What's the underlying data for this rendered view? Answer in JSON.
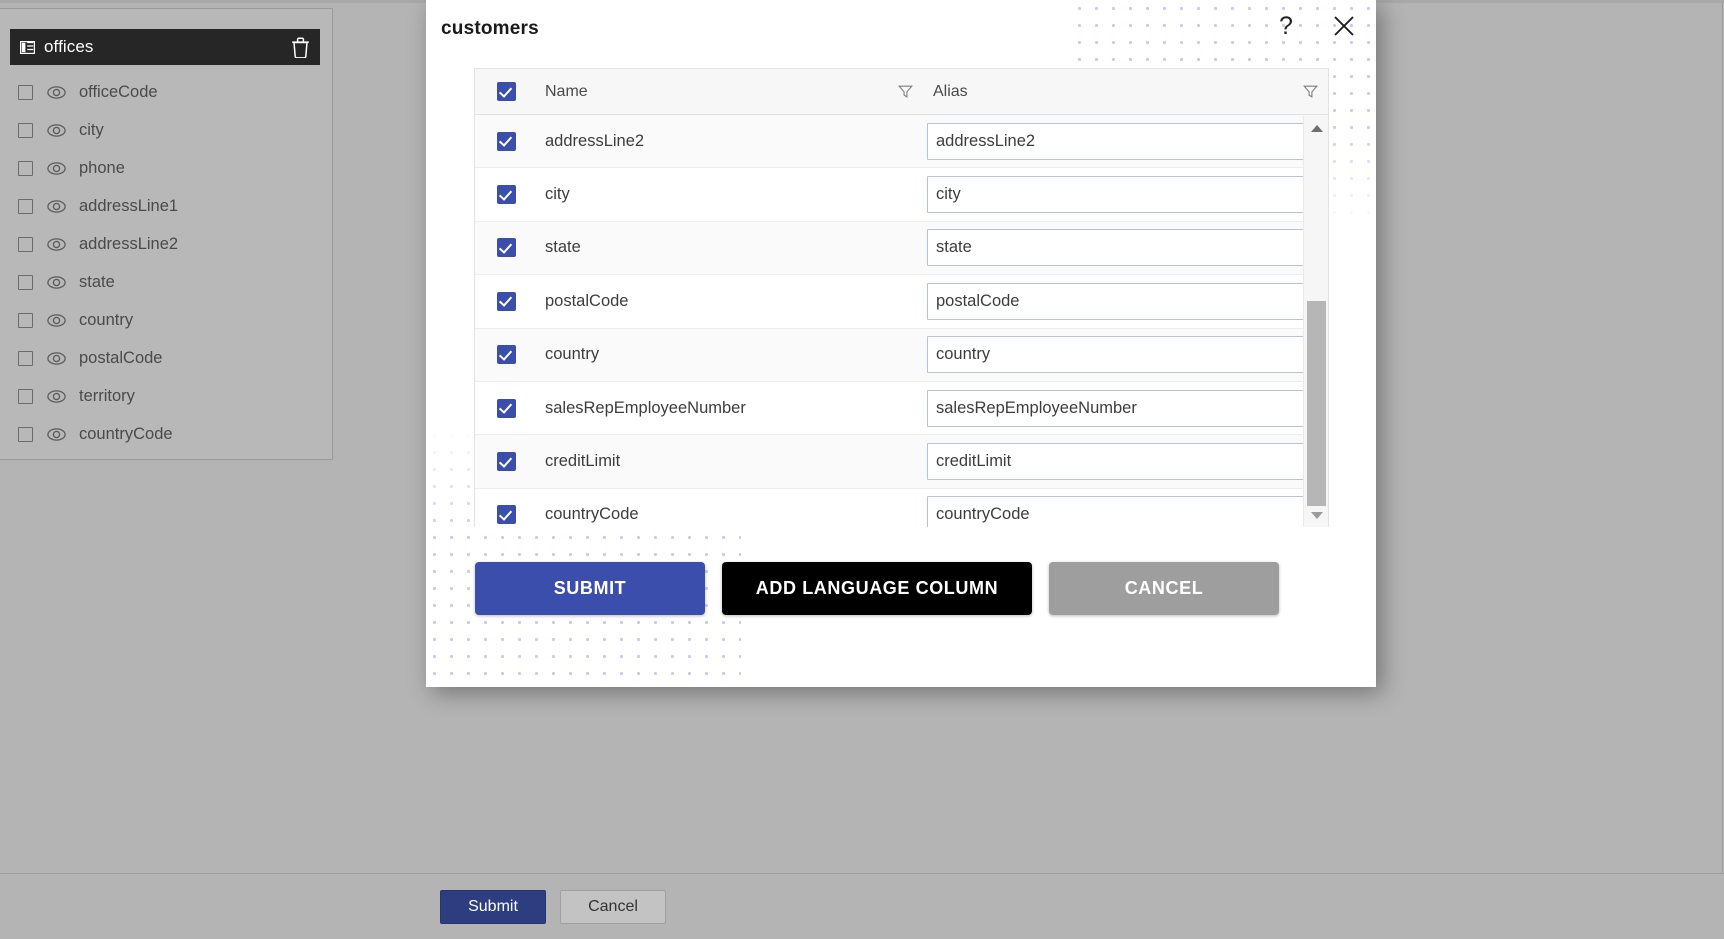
{
  "sidebar": {
    "header": {
      "icon": "table-grid-icon",
      "title": "offices",
      "delete_icon": "trash-icon"
    },
    "fields": [
      {
        "label": "officeCode"
      },
      {
        "label": "city"
      },
      {
        "label": "phone"
      },
      {
        "label": "addressLine1"
      },
      {
        "label": "addressLine2"
      },
      {
        "label": "state"
      },
      {
        "label": "country"
      },
      {
        "label": "postalCode"
      },
      {
        "label": "territory"
      },
      {
        "label": "countryCode"
      }
    ]
  },
  "dialog": {
    "title": "customers",
    "help_icon": "question-mark-icon",
    "close_icon": "close-icon",
    "table": {
      "header": {
        "select_all": true,
        "name_label": "Name",
        "alias_label": "Alias",
        "name_filter_icon": "filter-funnel-icon",
        "alias_filter_icon": "filter-funnel-icon"
      },
      "rows": [
        {
          "checked": true,
          "name": "addressLine2",
          "alias": "addressLine2"
        },
        {
          "checked": true,
          "name": "city",
          "alias": "city"
        },
        {
          "checked": true,
          "name": "state",
          "alias": "state"
        },
        {
          "checked": true,
          "name": "postalCode",
          "alias": "postalCode"
        },
        {
          "checked": true,
          "name": "country",
          "alias": "country"
        },
        {
          "checked": true,
          "name": "salesRepEmployeeNumber",
          "alias": "salesRepEmployeeNumber"
        },
        {
          "checked": true,
          "name": "creditLimit",
          "alias": "creditLimit"
        },
        {
          "checked": true,
          "name": "countryCode",
          "alias": "countryCode"
        }
      ]
    },
    "scrollbar": {
      "up_icon": "scroll-up-arrow-icon",
      "down_icon": "scroll-down-arrow-icon"
    },
    "buttons": {
      "submit": "SUBMIT",
      "add_language_column": "ADD LANGUAGE COLUMN",
      "cancel": "CANCEL"
    }
  },
  "bottom_bar": {
    "submit": "Submit",
    "cancel": "Cancel"
  },
  "colors": {
    "accent_blue": "#3b4eab",
    "page_background": "#b4b4b4",
    "sidebar_header": "#262626",
    "black_button": "#000000",
    "gray_button": "#9e9e9e",
    "dot_pattern": "#9aa3dd"
  }
}
